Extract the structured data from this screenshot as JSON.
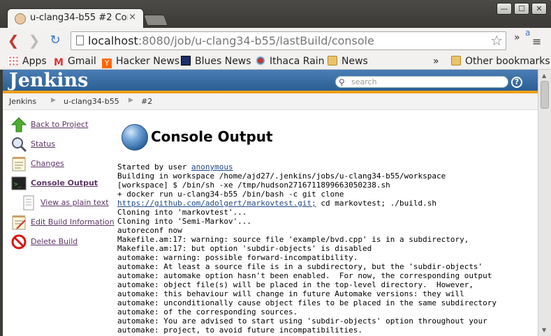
{
  "window": {
    "tab_title": "u-clang34-b55 #2 Con",
    "tab_close": "×",
    "min": "—",
    "max": "☐",
    "close": "✕"
  },
  "toolbar": {
    "url_host": "localhost",
    "url_rest": ":8080/job/u-clang34-b55/lastBuild/console",
    "overflow": "»"
  },
  "bookmarks": {
    "items": [
      "Apps",
      "Gmail",
      "Hacker News",
      "Blues News",
      "Ithaca Rain",
      "News"
    ],
    "overflow": "»",
    "other": "Other bookmarks"
  },
  "jenkins": {
    "logo": "Jenkins",
    "search_placeholder": "search",
    "help": "?",
    "breadcrumbs": [
      "Jenkins",
      "u-clang34-b55",
      "#2"
    ],
    "sidebar": [
      "Back to Project",
      "Status",
      "Changes",
      "Console Output",
      "View as plain text",
      "Edit Build Information",
      "Delete Build"
    ],
    "title": "Console Output",
    "console": {
      "line1_prefix": "Started by user ",
      "line1_link": "anonymous",
      "line2": "Building in workspace /home/ajd27/.jenkins/jobs/u-clang34-b55/workspace",
      "line3": "[workspace] $ /bin/sh -xe /tmp/hudson2716711899663050238.sh",
      "line4": "+ docker run u-clang34-b55 /bin/bash -c git clone",
      "line5_link": "https://github.com/adolgert/markovtest.git;",
      "line5_rest": " cd markovtest; ./build.sh",
      "rest": "Cloning into 'markovtest'...\nCloning into 'Semi-Markov'...\nautoreconf now\nMakefile.am:17: warning: source file 'example/bvd.cpp' is in a subdirectory,\nMakefile.am:17: but option 'subdir-objects' is disabled\nautomake: warning: possible forward-incompatibility.\nautomake: At least a source file is in a subdirectory, but the 'subdir-objects'\nautomake: automake option hasn't been enabled.  For now, the corresponding output\nautomake: object file(s) will be placed in the top-level directory.  However,\nautomake: this behaviour will change in future Automake versions: they will\nautomake: unconditionally cause object files to be placed in the same subdirectory\nautomake: of the corresponding sources.\nautomake: You are advised to start using 'subdir-objects' option throughout your\nautomake: project, to avoid future incompatibilities."
    }
  }
}
